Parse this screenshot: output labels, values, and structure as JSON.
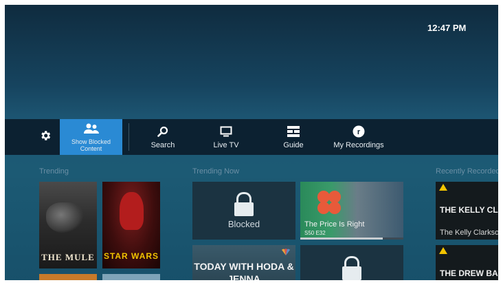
{
  "status": {
    "time": "12:47 PM"
  },
  "menu": {
    "settings_icon": "gear-icon",
    "show_blocked": {
      "label": "Show Blocked Content",
      "icon": "users-icon"
    },
    "search": {
      "label": "Search",
      "icon": "search-icon"
    },
    "live_tv": {
      "label": "Live TV",
      "icon": "monitor-icon"
    },
    "guide": {
      "label": "Guide",
      "icon": "guide-grid-icon"
    },
    "recordings": {
      "label": "My Recordings",
      "icon": "recordings-r-icon"
    }
  },
  "sections": {
    "trending": "Trending",
    "trending_now": "Trending Now",
    "recently_recorded": "Recently Recorded"
  },
  "trending": [
    {
      "title": "THE MULE"
    },
    {
      "title": "STAR WARS"
    }
  ],
  "trending_now": [
    {
      "blocked_label": "Blocked"
    },
    {
      "title": "The Price Is Right",
      "episode": "S50 E32",
      "progress": 0.8
    },
    {
      "title": "TODAY WITH HODA & JENNA",
      "network": "NBC"
    },
    {
      "blocked_label": ""
    }
  ],
  "recently_recorded": [
    {
      "title_art": "THE KELLY CLARKSON",
      "title": "The Kelly Clarkson"
    },
    {
      "title_art": "THE DREW BARRYMORE"
    }
  ],
  "colors": {
    "accent": "#2a8ad4",
    "menubar": "#0c2131",
    "warning": "#f2c400"
  }
}
